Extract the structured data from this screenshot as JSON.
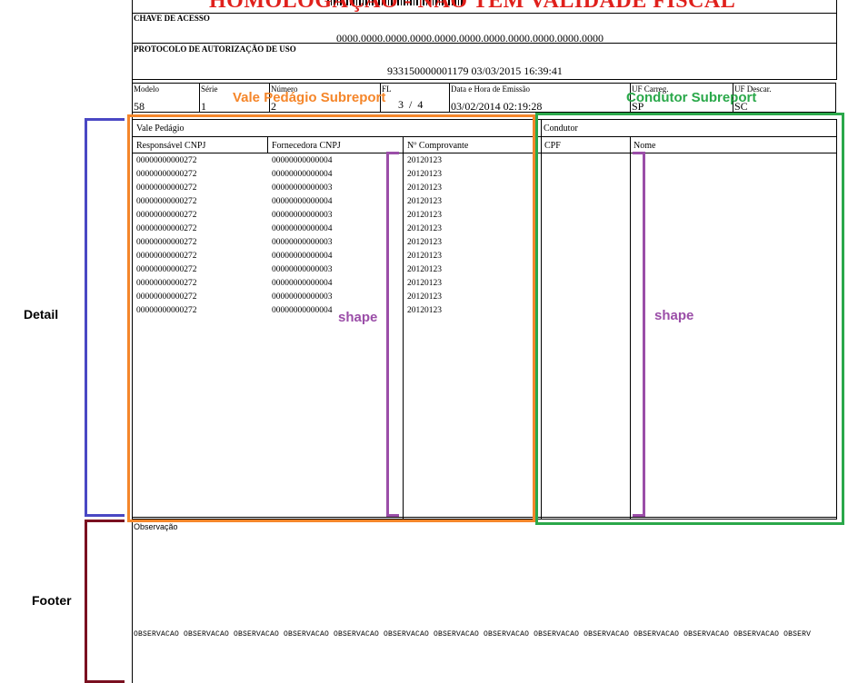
{
  "document": {
    "watermark": "HOMOLOGAÇÃO - NÃO TEM VALIDADE FISCAL",
    "chave_label": "CHAVE DE ACESSO",
    "chave_value": "0000.0000.0000.0000.0000.0000.0000.0000.0000.0000.0000",
    "protocolo_label": "PROTOCOLO DE AUTORIZAÇÃO DE USO",
    "protocolo_value": "933150000001179 03/03/2015 16:39:41",
    "header_fields": [
      {
        "label": "Modelo",
        "value": "58"
      },
      {
        "label": "Série",
        "value": "1"
      },
      {
        "label": "Número",
        "value": "2"
      },
      {
        "label": "FL",
        "value": "3  /  4"
      },
      {
        "label": "Data e Hora de Emissão",
        "value": "03/02/2014 02:19:28"
      },
      {
        "label": "UF Carreg.",
        "value": "SP"
      },
      {
        "label": "UF Descar.",
        "value": "SC"
      }
    ],
    "vale_pedagio": {
      "title": "Vale Pedágio",
      "columns": [
        "Responsável CNPJ",
        "Fornecedora CNPJ",
        "Nº Comprovante"
      ],
      "rows": [
        [
          "00000000000272",
          "00000000000004",
          "20120123"
        ],
        [
          "00000000000272",
          "00000000000004",
          "20120123"
        ],
        [
          "00000000000272",
          "00000000000003",
          "20120123"
        ],
        [
          "00000000000272",
          "00000000000004",
          "20120123"
        ],
        [
          "00000000000272",
          "00000000000003",
          "20120123"
        ],
        [
          "00000000000272",
          "00000000000004",
          "20120123"
        ],
        [
          "00000000000272",
          "00000000000003",
          "20120123"
        ],
        [
          "00000000000272",
          "00000000000004",
          "20120123"
        ],
        [
          "00000000000272",
          "00000000000003",
          "20120123"
        ],
        [
          "00000000000272",
          "00000000000004",
          "20120123"
        ],
        [
          "00000000000272",
          "00000000000003",
          "20120123"
        ],
        [
          "00000000000272",
          "00000000000004",
          "20120123"
        ]
      ]
    },
    "condutor": {
      "title": "Condutor",
      "columns": [
        "CPF",
        "Nome"
      ]
    },
    "observacao_label": "Observação",
    "observacao_text": "OBSERVACAO OBSERVACAO OBSERVACAO OBSERVACAO OBSERVACAO OBSERVACAO OBSERVACAO OBSERVACAO OBSERVACAO OBSERVACAO OBSERVACAO OBSERVACAO OBSERVACAO OBSERV"
  },
  "annotations": {
    "vale_pedagio_subreport": "Vale Pedágio Subreport",
    "condutor_subreport": "Condutor Subreport",
    "shape_left": "shape",
    "shape_right": "shape",
    "detail": "Detail",
    "footer": "Footer"
  },
  "colors": {
    "watermark": "#e0201c",
    "vale_pedagio_box": "#f5862a",
    "condutor_box": "#2aa84a",
    "shape": "#9b4ea8",
    "detail_bracket": "#4a48c4",
    "footer_bracket": "#7a1020"
  }
}
